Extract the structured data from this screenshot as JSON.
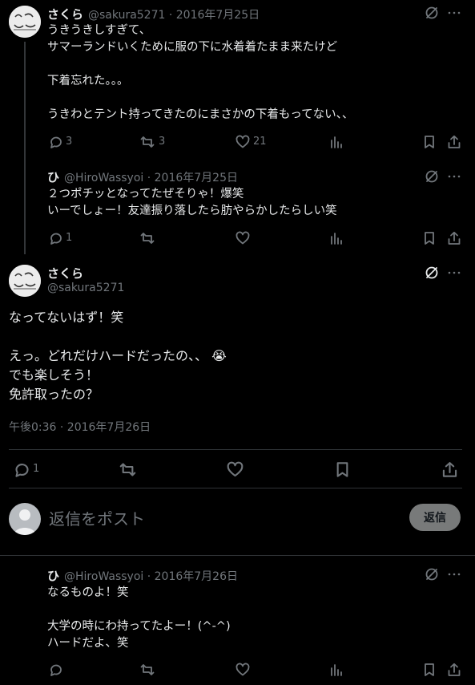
{
  "tweet1": {
    "name": "さくら",
    "meta": "@sakura5271 · 2016年7月25日",
    "text": "うきうきしすぎて、\nサマーランドいくために服の下に水着着たまま来たけど\n\n下着忘れた。。。\n\nうきわとテント持ってきたのにまさかの下着もってない、、",
    "replies": "3",
    "retweets": "3",
    "likes": "21"
  },
  "tweet2": {
    "name": "ひ",
    "meta": "@HiroWassyoi · 2016年7月25日",
    "text": "２つポチッとなってたぜそりゃ！爆笑\nいーでしょー！友達振り落したら肪やらかしたらしい笑",
    "replies": "1"
  },
  "main_tweet": {
    "name": "さくら",
    "handle": "@sakura5271",
    "text": "なってないはず！笑\n\nえっ。どれだけハードだったの、、 😭\nでも楽しそう！\n免許取ったの？",
    "timestamp": "午後0:36 · 2016年7月26日",
    "replies": "1"
  },
  "composer": {
    "placeholder": "返信をポスト",
    "button": "返信"
  },
  "tweet3": {
    "name": "ひ",
    "meta": "@HiroWassyoi · 2016年7月26日",
    "text": "なるものよ！笑\n\n大学の時にわ持ってたよー！(^-^)\nハードだよ、笑"
  },
  "colors": {
    "background": "#000000",
    "text": "#e7e9ea",
    "muted": "#71767b",
    "divider": "#2f3336"
  },
  "icons": [
    "grok-icon",
    "more-icon",
    "reply-icon",
    "retweet-icon",
    "like-icon",
    "views-icon",
    "bookmark-icon",
    "share-icon"
  ]
}
